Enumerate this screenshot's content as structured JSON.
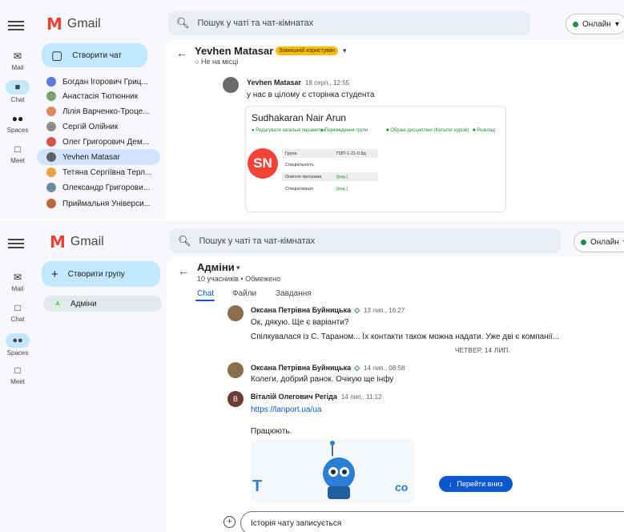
{
  "top": {
    "logo_text": "Gmail",
    "search_placeholder": "Пошук у чаті та чат-кімнатах",
    "status": "Онлайн",
    "rail": {
      "mail": "Mail",
      "chat": "Chat",
      "spaces": "Spaces",
      "meet": "Meet"
    },
    "create_button": "Створити чат",
    "chats": [
      {
        "name": "Богдан Ігорович Гриц...",
        "color": "#5e7ce0"
      },
      {
        "name": "Анастасія Тютюнник",
        "color": "#7aa36a"
      },
      {
        "name": "Лілія Варченко-Троце...",
        "color": "#d98a5c"
      },
      {
        "name": "Сергій Олійник",
        "color": "#8d8d8d"
      },
      {
        "name": "Олег Григорович Дем...",
        "color": "#d9534f"
      },
      {
        "name": "Yevhen Matasar",
        "color": "#5f6368"
      },
      {
        "name": "Тетяна Сергіївна Терл...",
        "color": "#e8a33d"
      },
      {
        "name": "Олександр Григорови...",
        "color": "#6b8e9f"
      },
      {
        "name": "Приймальня Універси...",
        "color": "#c0673d"
      }
    ],
    "header": {
      "title": "Yevhen Matasar",
      "badge": "Зовнішній користувач",
      "status": "Не на місці"
    },
    "message": {
      "author": "Yevhen Matasar",
      "time": "18 серп., 12:55",
      "text": "у нас в цілому є сторінка студента"
    },
    "card": {
      "title": "Sudhakaran Nair Arun",
      "actions": [
        "Редагувати загальні параметри",
        "Переведення групи",
        "Обрані дисципліни (Каталог курсів)",
        "Розклад"
      ],
      "initials": "SN",
      "rows": [
        {
          "k": "Група",
          "v": "ПЗП-1-21-0.8д"
        },
        {
          "k": "Спеціальність",
          "v": ""
        },
        {
          "k": "Освітня програма",
          "v": "[ред.]"
        },
        {
          "k": "Спеціалізація",
          "v": "[ред.]"
        }
      ]
    }
  },
  "bottom": {
    "logo_text": "Gmail",
    "search_placeholder": "Пошук у чаті та чат-кімнатах",
    "status": "Онлайн",
    "rail": {
      "mail": "Mail",
      "chat": "Chat",
      "spaces": "Spaces",
      "meet": "Meet"
    },
    "create_button": "Створити групу",
    "groups": [
      {
        "letter": "А",
        "name": "Адміни"
      }
    ],
    "header": {
      "title": "Адміни",
      "subtitle": "10 учасників • Обмежено",
      "tabs": [
        "Chat",
        "Файли",
        "Завдання"
      ]
    },
    "messages": [
      {
        "author": "Оксана Петрівна Буйницька",
        "time": "13 лип., 16:27",
        "lines": [
          "Ок, дякую. Ще є варіанти?",
          "Спілкувалася із С. Тараном... Їх контакти також можна надати. Уже дві є компанії..."
        ]
      },
      {
        "author": "Оксана Петрівна Буйницька",
        "time": "14 лип., 08:58",
        "lines": [
          "Колеги, добрий ранок. Очікую ще інфу"
        ]
      },
      {
        "author": "Віталій Олегович Регіда",
        "time": "14 лип., 11:12",
        "initial": "В",
        "link": "https://lanport.ua/ua",
        "lines": [
          "Працюють."
        ]
      }
    ],
    "date_separator": "ЧЕТВЕР, 14 ЛИП.",
    "jump_button": "Перейти вниз",
    "composer_placeholder": "Історія чату записується"
  },
  "colors": {
    "accent": "#0b57d0",
    "selected": "#c2e7ff",
    "online": "#1e8e3e",
    "badge": "#fbbc04"
  }
}
